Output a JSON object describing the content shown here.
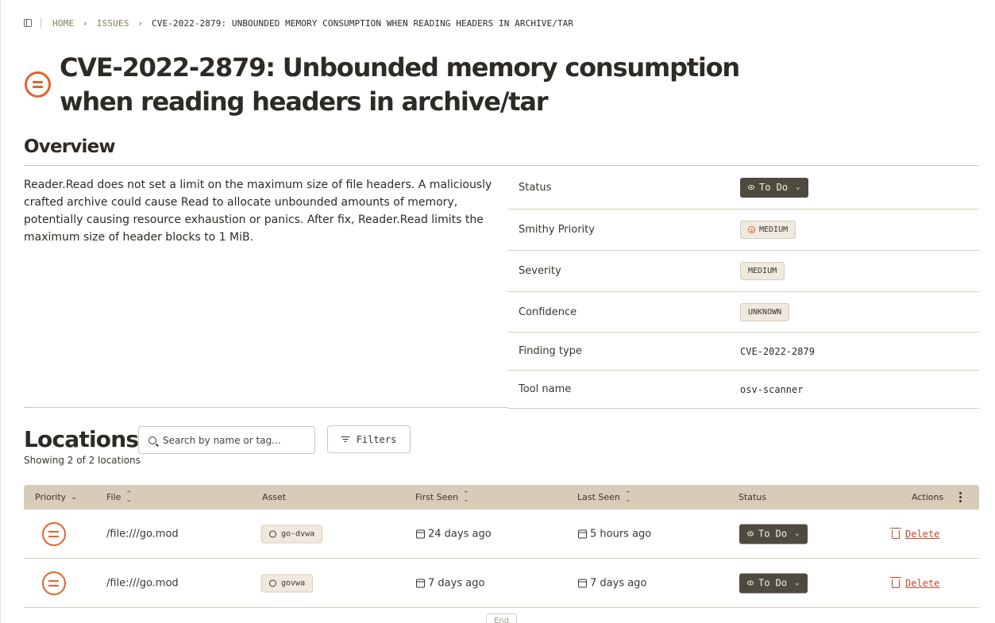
{
  "breadcrumb": {
    "home": "HOME",
    "issues": "ISSUES",
    "current": "CVE-2022-2879: UNBOUNDED MEMORY CONSUMPTION WHEN READING HEADERS IN ARCHIVE/TAR"
  },
  "page": {
    "title": "CVE-2022-2879: Unbounded memory consumption when reading headers in archive/tar",
    "priority_icon": "priority-medium-icon"
  },
  "overview": {
    "heading": "Overview",
    "description": "Reader.Read does not set a limit on the maximum size of file headers. A maliciously crafted archive could cause Read to allocate unbounded amounts of memory, potentially causing resource exhaustion or panics. After fix, Reader.Read limits the maximum size of header blocks to 1 MiB.",
    "fields": {
      "status_label": "Status",
      "status_value": "To Do",
      "smithy_priority_label": "Smithy Priority",
      "smithy_priority_value": "MEDIUM",
      "severity_label": "Severity",
      "severity_value": "MEDIUM",
      "confidence_label": "Confidence",
      "confidence_value": "UNKNOWN",
      "finding_type_label": "Finding type",
      "finding_type_value": "CVE-2022-2879",
      "tool_name_label": "Tool name",
      "tool_name_value": "osv-scanner"
    }
  },
  "locations": {
    "heading": "Locations",
    "search_placeholder": "Search by name or tag...",
    "filters_label": "Filters",
    "count_text": "Showing 2 of 2 locations",
    "columns": {
      "priority": "Priority",
      "file": "File",
      "asset": "Asset",
      "first_seen": "First Seen",
      "last_seen": "Last Seen",
      "status": "Status",
      "actions": "Actions"
    },
    "rows": [
      {
        "file": "/file:///go.mod",
        "asset": "go-dvwa",
        "first_seen": "24 days ago",
        "last_seen": "5 hours ago",
        "status": "To Do",
        "action": "Delete"
      },
      {
        "file": "/file:///go.mod",
        "asset": "govwa",
        "first_seen": "7 days ago",
        "last_seen": "7 days ago",
        "status": "To Do",
        "action": "Delete"
      }
    ],
    "end_label": "End"
  },
  "colors": {
    "accent": "#e2632f",
    "header_bg": "#d6ccb8",
    "status_pill": "#4f4a3f",
    "danger": "#c8472b"
  }
}
